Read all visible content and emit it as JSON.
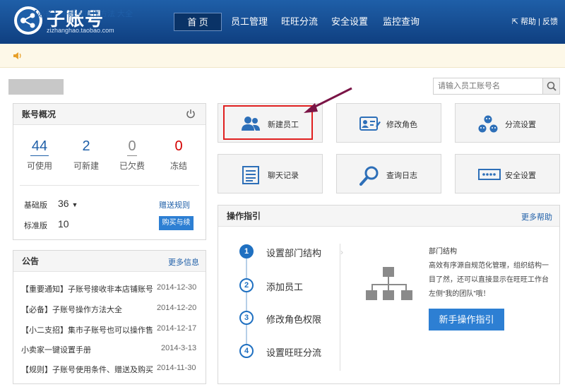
{
  "header": {
    "logo_title": "子账号",
    "logo_sub": "zizhanghao.taobao.com",
    "nav": [
      "首 页",
      "员工管理",
      "旺旺分流",
      "安全设置",
      "监控查询"
    ],
    "help": "帮助",
    "feedback": "反馈"
  },
  "notice": {
    "text": "【必备】子账号操作方法 大全"
  },
  "search": {
    "placeholder": "请输入员工账号名"
  },
  "account": {
    "title": "账号概况",
    "stats": [
      {
        "value": "44",
        "label": "可使用",
        "color": "#1f5fa8"
      },
      {
        "value": "2",
        "label": "可新建",
        "color": "#1f5fa8"
      },
      {
        "value": "0",
        "label": "已欠费",
        "color": "#888888"
      },
      {
        "value": "0",
        "label": "冻结",
        "color": "#d40000"
      }
    ],
    "basic_label": "基础版",
    "basic_value": "36",
    "gift_rule": "赠送规则",
    "standard_label": "标准版",
    "standard_value": "10",
    "buy_button": "购买与续费"
  },
  "notices": {
    "title": "公告",
    "more": "更多信息",
    "items": [
      {
        "text": "【重要通知】子账号接收非本店铺账号发送",
        "date": "2014-12-30"
      },
      {
        "text": "【必备】子账号操作方法大全",
        "date": "2014-12-20"
      },
      {
        "text": "【小二支招】集市子账号也可以操作售后退",
        "date": "2014-12-17"
      },
      {
        "text": "小卖家一键设置手册",
        "date": "2014-3-13"
      },
      {
        "text": "【规则】子账号使用条件、赠送及购买规则",
        "date": "2014-11-30"
      }
    ]
  },
  "tiles": [
    {
      "label": "新建员工",
      "icon": "users-icon"
    },
    {
      "label": "修改角色",
      "icon": "id-card-edit-icon"
    },
    {
      "label": "分流设置",
      "icon": "flow-split-icon"
    },
    {
      "label": "聊天记录",
      "icon": "document-lines-icon"
    },
    {
      "label": "查询日志",
      "icon": "magnifier-icon"
    },
    {
      "label": "安全设置",
      "icon": "password-dots-icon"
    }
  ],
  "guide": {
    "title": "操作指引",
    "more": "更多帮助",
    "steps": [
      {
        "num": "1",
        "label": "设置部门结构"
      },
      {
        "num": "2",
        "label": "添加员工"
      },
      {
        "num": "3",
        "label": "修改角色权限"
      },
      {
        "num": "4",
        "label": "设置旺旺分流"
      }
    ],
    "detail_title": "部门结构",
    "detail_text": "高效有序源自规范化管理，组织结构一目了然，还可以直接显示在旺旺工作台左侧“我的团队”哦！",
    "button": "新手操作指引"
  },
  "colors": {
    "brand": "#1f5fa8",
    "accent": "#2d7fd3",
    "highlight": "#e02020",
    "arrow": "#7a1446"
  }
}
